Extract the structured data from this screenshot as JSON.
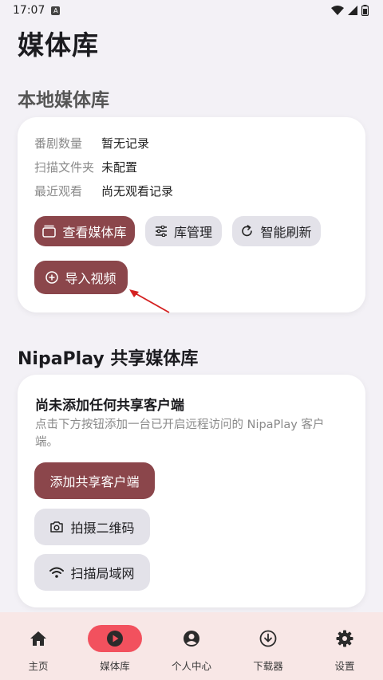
{
  "status": {
    "time": "17:07",
    "notif_glyph": "A"
  },
  "page_title": "媒体库",
  "local": {
    "title": "本地媒体库",
    "rows": [
      {
        "label": "番剧数量",
        "value": "暂无记录"
      },
      {
        "label": "扫描文件夹",
        "value": "未配置"
      },
      {
        "label": "最近观看",
        "value": "尚无观看记录"
      }
    ],
    "buttons": {
      "view": "查看媒体库",
      "manage": "库管理",
      "refresh": "智能刷新",
      "import": "导入视频"
    }
  },
  "share": {
    "title": "NipaPlay 共享媒体库",
    "heading": "尚未添加任何共享客户端",
    "desc": "点击下方按钮添加一台已开启远程访问的 NipaPlay 客户端。",
    "buttons": {
      "add": "添加共享客户端",
      "scan_qr": "拍摄二维码",
      "scan_lan": "扫描局域网"
    }
  },
  "nav": {
    "items": [
      {
        "label": "主页",
        "icon": "home-icon"
      },
      {
        "label": "媒体库",
        "icon": "play-circle-icon",
        "active": true
      },
      {
        "label": "个人中心",
        "icon": "account-icon"
      },
      {
        "label": "下载器",
        "icon": "download-icon"
      },
      {
        "label": "设置",
        "icon": "gear-icon"
      }
    ]
  },
  "colors": {
    "primary_button": "#8b464b",
    "secondary_button": "#e3e2e9",
    "nav_active": "#f2515e",
    "nav_background": "#f8e7e6",
    "annotation_arrow": "#d42020"
  }
}
